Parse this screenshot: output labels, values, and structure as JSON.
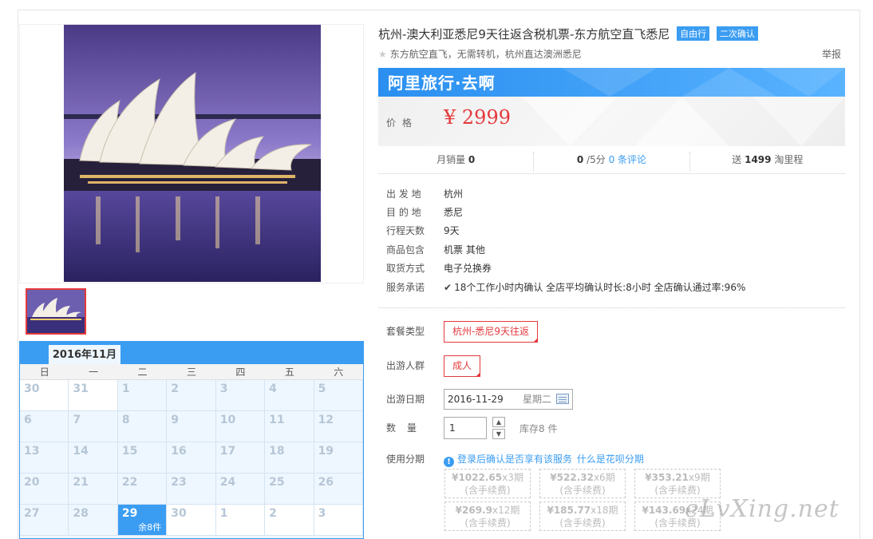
{
  "product": {
    "title": "杭州-澳大利亚悉尼9天往返含税机票-东方航空直飞悉尼",
    "badges": [
      "自由行",
      "二次确认"
    ],
    "subtitle": "东方航空直飞，无需转机，杭州直达澳洲悉尼",
    "report": "举报"
  },
  "banner": {
    "text": "阿里旅行·去啊"
  },
  "price": {
    "label": "价格",
    "value": "¥ 2999"
  },
  "stats": {
    "monthly_sales_label": "月销量",
    "monthly_sales_value": "0",
    "rating_value": "0",
    "rating_suffix": "/5分",
    "reviews_link": "0 条评论",
    "points_prefix": "送",
    "points_value": "1499",
    "points_suffix": "淘里程"
  },
  "info": [
    {
      "label": "出 发 地",
      "value": "杭州"
    },
    {
      "label": "目 的 地",
      "value": "悉尼"
    },
    {
      "label": "行程天数",
      "value": "9天"
    },
    {
      "label": "商品包含",
      "value": "机票  其他"
    },
    {
      "label": "取货方式",
      "value": "电子兑换券"
    },
    {
      "label": "服务承诺",
      "value": "18个工作小时内确认    全店平均确认时长:8小时    全店确认通过率:96%"
    }
  ],
  "options": {
    "package_label": "套餐类型",
    "package_value": "杭州-悉尼9天往返",
    "people_label": "出游人群",
    "people_value": "成人",
    "date_label": "出游日期",
    "date_value": "2016-11-29",
    "weekday": "星期二",
    "qty_label": "数量",
    "qty_value": "1",
    "stock": "库存8 件",
    "installment_label": "使用分期",
    "installment_note": "登录后确认是否享有该服务",
    "installment_link": "什么是花呗分期"
  },
  "installments": [
    {
      "amount": "¥1022.65",
      "period": "x3期",
      "fee": "(含手续费)"
    },
    {
      "amount": "¥522.32",
      "period": "x6期",
      "fee": "(含手续费)"
    },
    {
      "amount": "¥353.21",
      "period": "x9期",
      "fee": "(含手续费)"
    },
    {
      "amount": "¥269.9",
      "period": "x12期",
      "fee": "(含手续费)"
    },
    {
      "amount": "¥185.77",
      "period": "x18期",
      "fee": "(含手续费)"
    },
    {
      "amount": "¥143.69",
      "period": "x24期",
      "fee": "(含手续费)"
    }
  ],
  "calendar": {
    "month": "2016年11月",
    "weekdays": [
      "日",
      "一",
      "二",
      "三",
      "四",
      "五",
      "六"
    ],
    "days": [
      "30",
      "31",
      "1",
      "2",
      "3",
      "4",
      "5",
      "6",
      "7",
      "8",
      "9",
      "10",
      "11",
      "12",
      "13",
      "14",
      "15",
      "16",
      "17",
      "18",
      "19",
      "20",
      "21",
      "22",
      "23",
      "24",
      "25",
      "26",
      "27",
      "28",
      "29",
      "30",
      "1",
      "2",
      "3"
    ],
    "selected_stock": "余8件"
  },
  "watermark": "eLvXing.net",
  "colors": {
    "accent": "#3b9df2",
    "price": "#e4393c"
  }
}
